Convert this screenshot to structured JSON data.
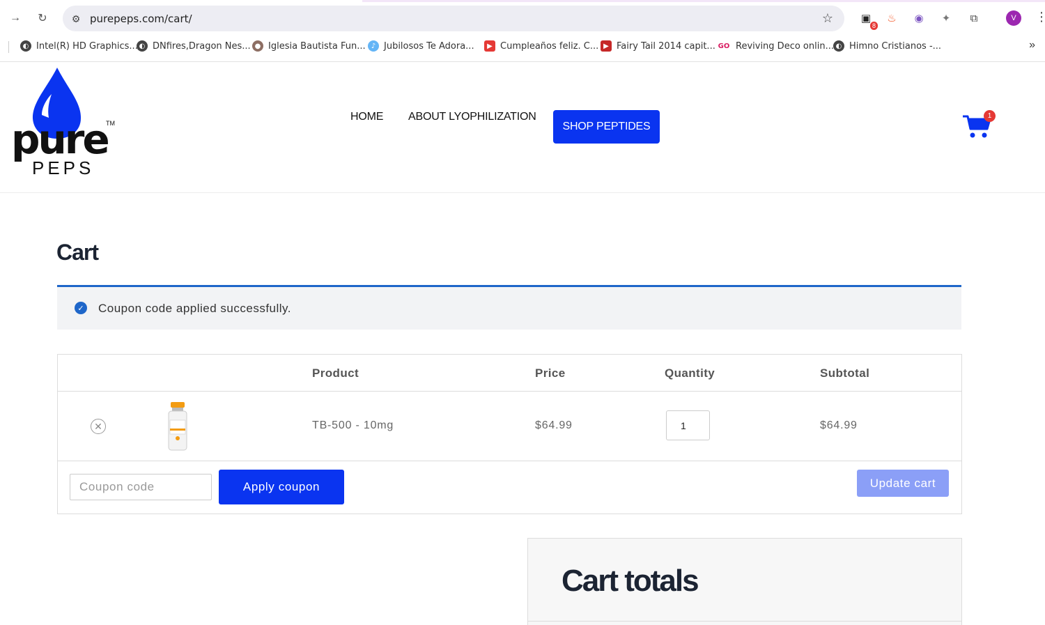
{
  "browser": {
    "url": "purepeps.com/cart/",
    "profile_initial": "V",
    "extension_badge": "8",
    "bookmarks": [
      "Intel(R) HD Graphics...",
      "DNfires,Dragon Nes...",
      "Iglesia Bautista Fun...",
      "Jubilosos Te Adora...",
      "Cumpleaños feliz. C...",
      "Fairy Tail 2014 capit...",
      "Reviving Deco onlin...",
      "Himno Cristianos -..."
    ]
  },
  "site": {
    "logo": {
      "word": "pure",
      "sub": "PEPS",
      "tm": "TM"
    },
    "nav": {
      "home": "HOME",
      "about": "ABOUT LYOPHILIZATION",
      "shop": "SHOP PEPTIDES"
    },
    "cart_count": "1",
    "colors": {
      "brand_blue": "#0a34f0",
      "notice_blue": "#1e66c9",
      "badge_red": "#e53935"
    }
  },
  "page": {
    "title": "Cart",
    "notice": "Coupon code applied successfully.",
    "table": {
      "headers": {
        "product": "Product",
        "price": "Price",
        "quantity": "Quantity",
        "subtotal": "Subtotal"
      },
      "rows": [
        {
          "product": "TB-500 - 10mg",
          "price": "$64.99",
          "quantity": "1",
          "subtotal": "$64.99"
        }
      ]
    },
    "coupon_placeholder": "Coupon code",
    "apply_label": "Apply coupon",
    "update_label": "Update cart",
    "totals_title": "Cart totals"
  }
}
